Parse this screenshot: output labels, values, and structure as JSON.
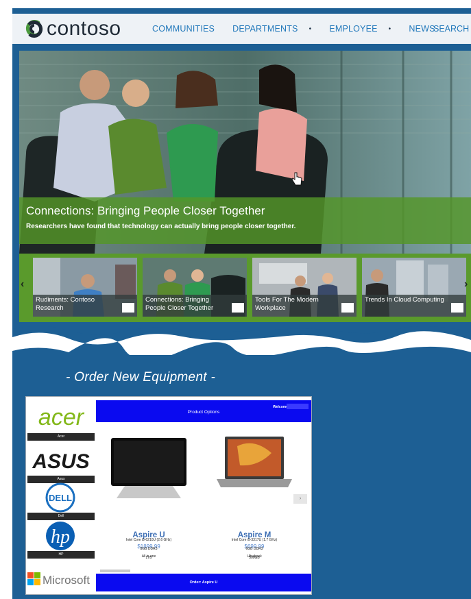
{
  "site": {
    "logo_text": "contoso",
    "nav": [
      {
        "label": "COMMUNITIES",
        "has_caret": false
      },
      {
        "label": "DEPARTMENTS",
        "has_caret": true
      },
      {
        "label": "EMPLOYEE",
        "has_caret": true
      },
      {
        "label": "NEWS",
        "has_caret": false
      }
    ],
    "search_label": "SEARCH",
    "caret_glyph": "•"
  },
  "hero": {
    "title": "Connections: Bringing People Closer Together",
    "subtitle": "Researchers have found that technology can actually bring people closer together."
  },
  "carousel": {
    "prev_glyph": "‹",
    "next_glyph": "›",
    "tiles": [
      {
        "label": "Rudiments: Contoso Research"
      },
      {
        "label": "Connections: Bringing People Closer Together"
      },
      {
        "label": "Tools For The Modern Workplace"
      },
      {
        "label": "Trends In Cloud Computing"
      }
    ]
  },
  "order_heading": "- Order New Equipment -",
  "app": {
    "title": "Product Options",
    "welcome_label": "Welcome",
    "brands": [
      {
        "name": "acer",
        "caption": "Acer"
      },
      {
        "name": "ASUS",
        "caption": "Asus"
      },
      {
        "name": "DELL",
        "caption": "Dell"
      },
      {
        "name": "hp",
        "caption": "HP"
      },
      {
        "name": "Microsoft",
        "caption": ""
      }
    ],
    "products": [
      {
        "name": "Aspire U",
        "price": "$1899.99",
        "type": "All in one",
        "cpu": "Intel Core i5-6210U (2.6 GHz)",
        "ram": "8GB DDR3",
        "storage": "1TB"
      },
      {
        "name": "Aspire M",
        "price": "$699.99",
        "type": "Ultrabook",
        "cpu": "Intel Core i5-3317U (1.7 GHz)",
        "ram": "6GB DDR3",
        "storage": "500GB"
      }
    ],
    "next_glyph": "›",
    "order_button": "Order: Aspire U"
  },
  "colors": {
    "brand_blue": "#1d5f94",
    "nav_blue": "#2379bb",
    "caption_green": "#549628",
    "app_blue": "#0a0af0",
    "price_blue": "#5a8ad0"
  }
}
